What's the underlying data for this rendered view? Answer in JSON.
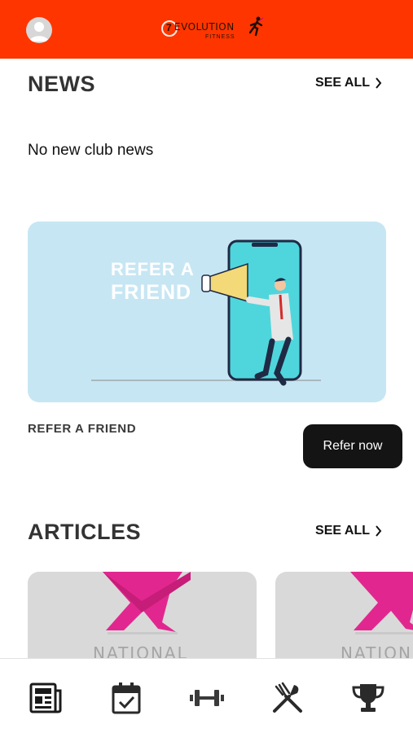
{
  "header": {
    "logo_number": "7",
    "logo_name": "EVOLUTION",
    "logo_sub": "FITNESS",
    "bar_color": "#ff3500"
  },
  "news": {
    "title": "NEWS",
    "see_all": "SEE ALL",
    "empty_text": "No new club news"
  },
  "refer": {
    "banner_text_line1": "REFER A",
    "banner_text_line2": "FRIEND",
    "label": "REFER A FRIEND",
    "button": "Refer now"
  },
  "articles": {
    "title": "ARTICLES",
    "see_all": "SEE ALL",
    "items": [
      {
        "brand": "NATIONAL"
      },
      {
        "brand": "NATION"
      }
    ]
  },
  "bottom_nav": {
    "items": [
      {
        "icon": "news-icon"
      },
      {
        "icon": "calendar-check-icon"
      },
      {
        "icon": "dumbbell-icon"
      },
      {
        "icon": "fork-knife-icon"
      },
      {
        "icon": "trophy-icon"
      }
    ]
  }
}
